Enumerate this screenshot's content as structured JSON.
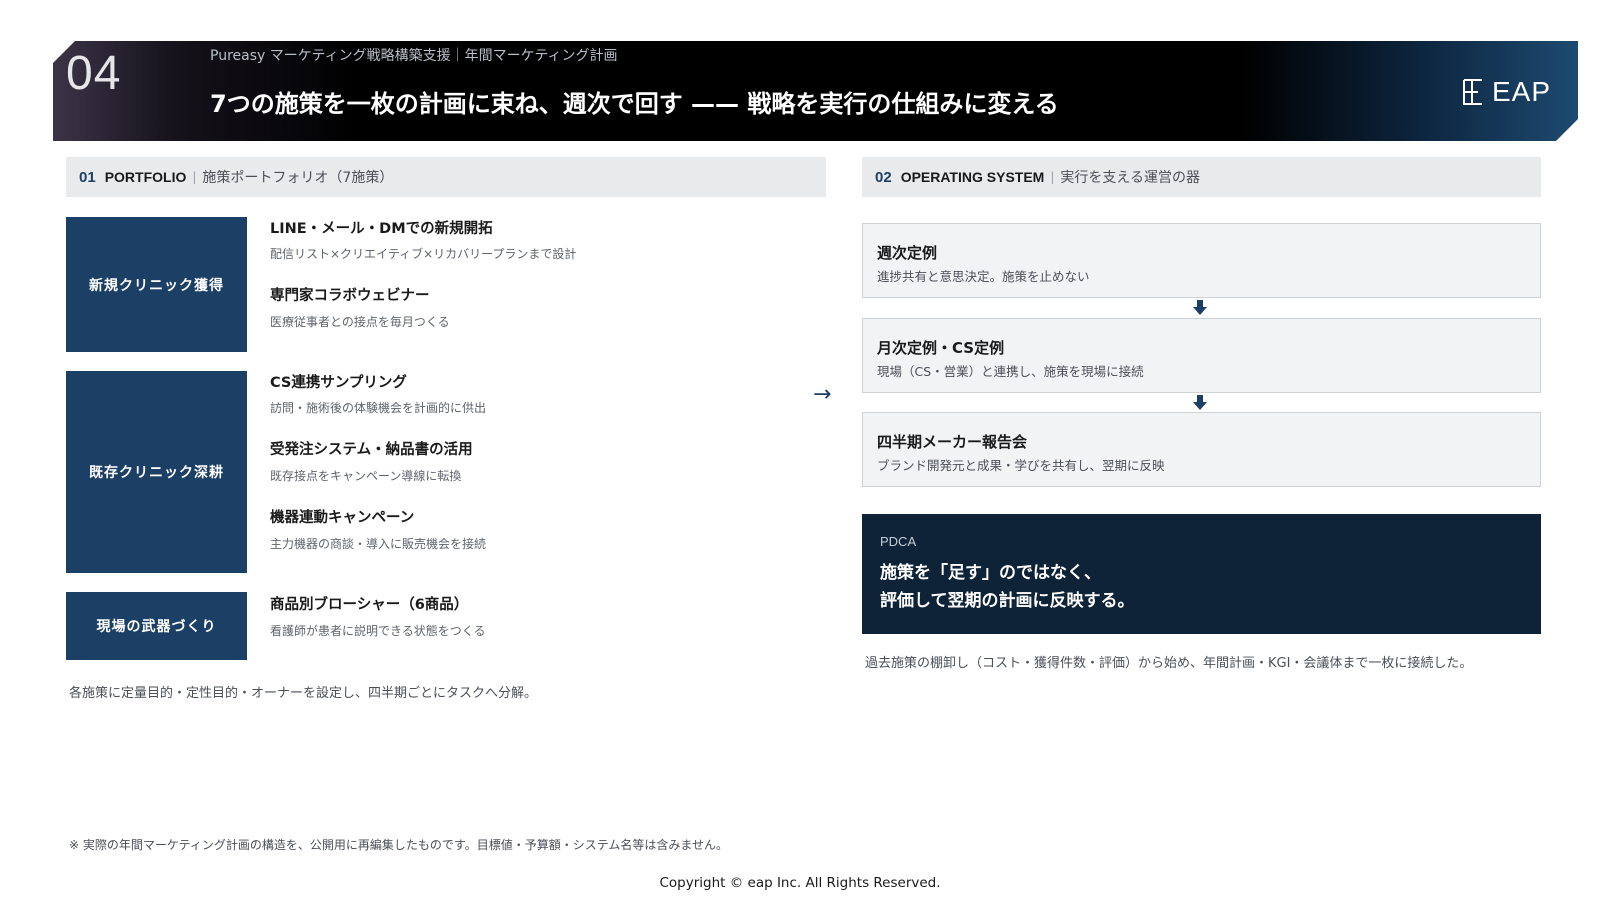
{
  "header": {
    "number": "04",
    "breadcrumb": "Pureasy マーケティング戦略構築支援｜年間マーケティング計画",
    "title": "7つの施策を一枚の計画に束ね、週次で回す —— 戦略を実行の仕組みに変える",
    "logo_text": "EAP"
  },
  "portfolio": {
    "num": "01",
    "en": "PORTFOLIO",
    "sep": "|",
    "jp": "施策ポートフォリオ（7施策）",
    "groups": [
      {
        "label": "新規クリニック獲得",
        "items": [
          {
            "title": "LINE・メール・DMでの新規開拓",
            "desc": "配信リスト×クリエイティブ×リカバリープランまで設計"
          },
          {
            "title": "専門家コラボウェビナー",
            "desc": "医療従事者との接点を毎月つくる"
          }
        ]
      },
      {
        "label": "既存クリニック深耕",
        "items": [
          {
            "title": "CS連携サンプリング",
            "desc": "訪問・施術後の体験機会を計画的に供出"
          },
          {
            "title": "受発注システム・納品書の活用",
            "desc": "既存接点をキャンペーン導線に転換"
          },
          {
            "title": "機器連動キャンペーン",
            "desc": "主力機器の商談・導入に販売機会を接続"
          }
        ]
      },
      {
        "label": "現場の武器づくり",
        "items": [
          {
            "title": "商品別ブローシャー（6商品）",
            "desc": "看護師が患者に説明できる状態をつくる"
          }
        ]
      }
    ],
    "note": "各施策に定量目的・定性目的・オーナーを設定し、四半期ごとにタスクへ分解。"
  },
  "connector": "→",
  "operating": {
    "num": "02",
    "en": "OPERATING SYSTEM",
    "sep": "|",
    "jp": "実行を支える運営の器",
    "steps": [
      {
        "title": "週次定例",
        "desc": "進捗共有と意思決定。施策を止めない"
      },
      {
        "title": "月次定例・CS定例",
        "desc": "現場（CS・営業）と連携し、施策を現場に接続"
      },
      {
        "title": "四半期メーカー報告会",
        "desc": "ブランド開発元と成果・学びを共有し、翌期に反映"
      }
    ],
    "pdca": {
      "tag": "PDCA",
      "line1": "施策を「足す」のではなく、",
      "line2": "評価して翌期の計画に反映する。"
    },
    "note": "過去施策の棚卸し（コスト・獲得件数・評価）から始め、年間計画・KGI・会議体まで一枚に接続した。"
  },
  "footer": {
    "disclaimer": "※ 実際の年間マーケティング計画の構造を、公開用に再編集したものです。目標値・予算額・システム名等は含みません。",
    "copyright": "Copyright © eap Inc. All Rights Reserved."
  },
  "colors": {
    "navy": "#1c3f66",
    "dark_navy": "#0e2238",
    "panel_gray": "#e9eaec"
  },
  "icons": {
    "logo": "eap-logo-mark",
    "step_arrow": "down-arrow-icon",
    "connector": "right-arrow-icon"
  }
}
